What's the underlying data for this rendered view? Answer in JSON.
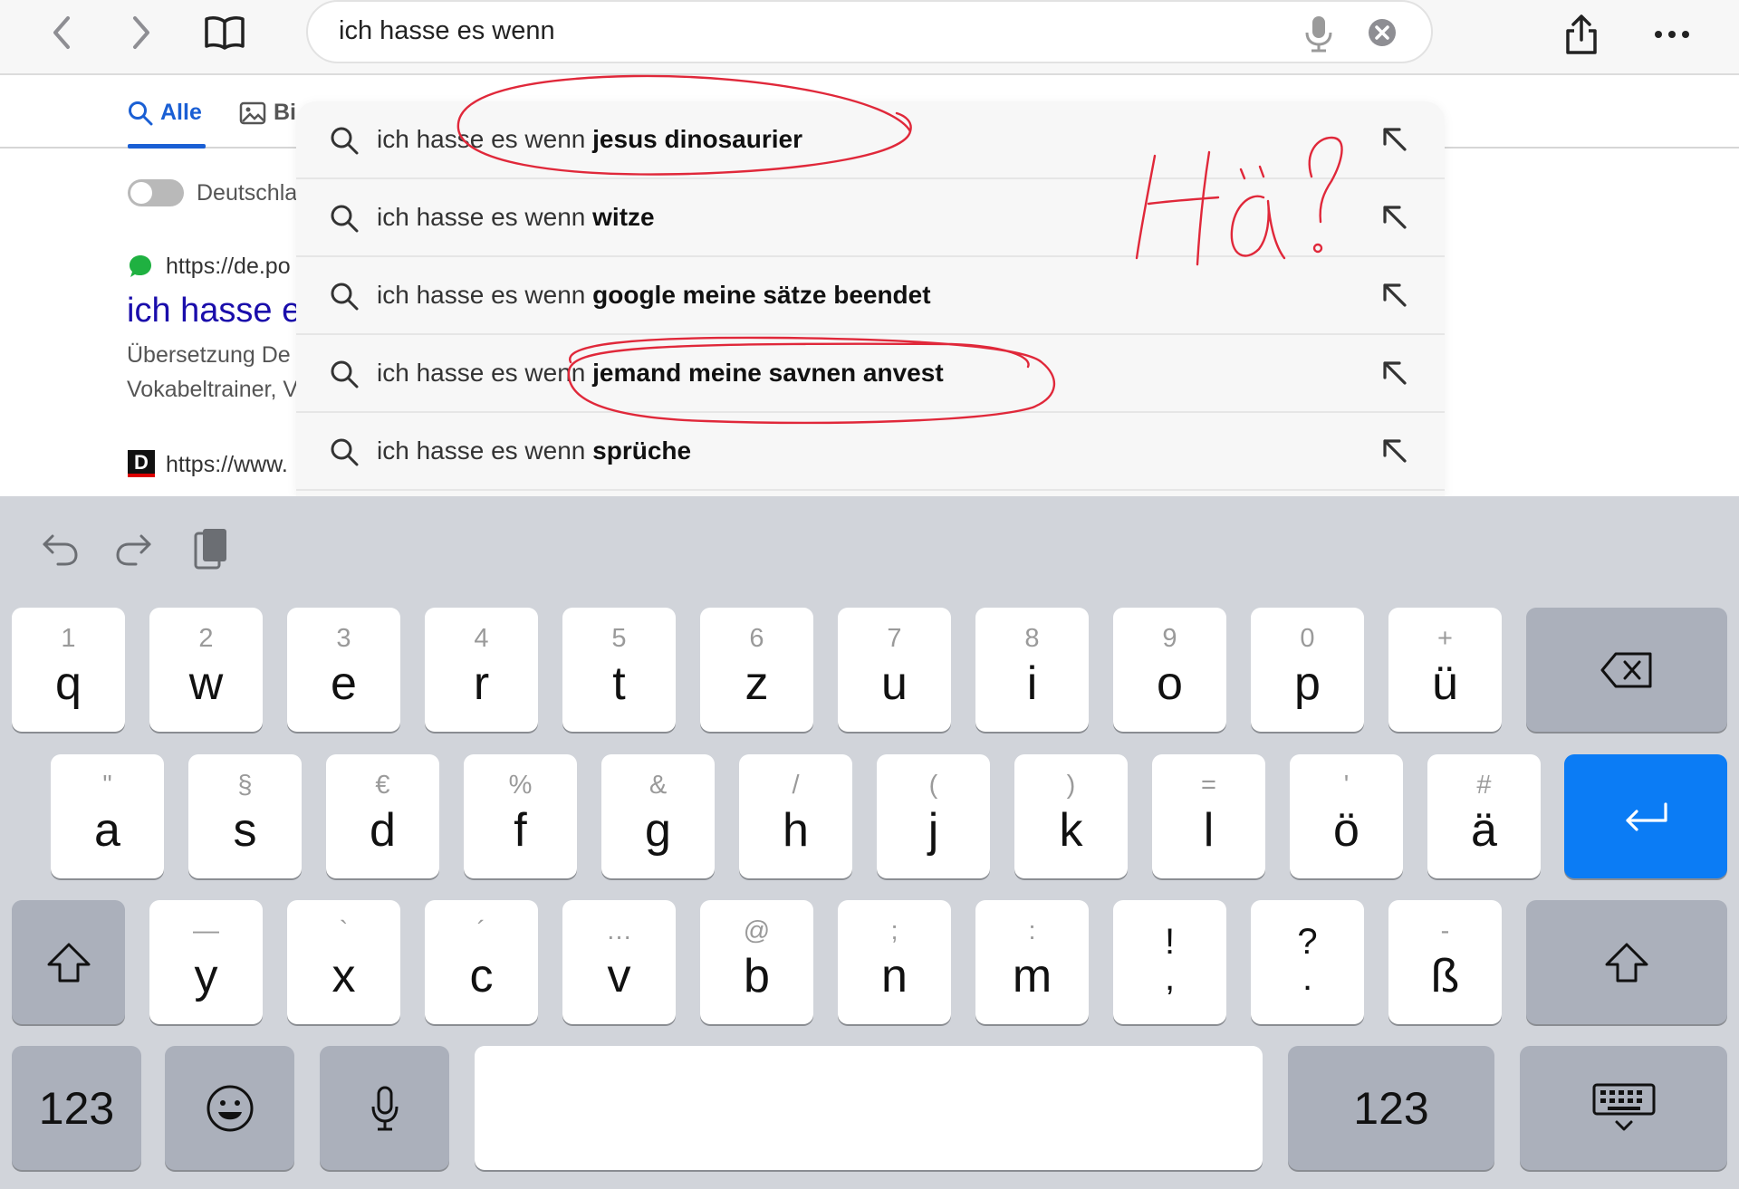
{
  "browser": {
    "search_query": "ich hasse es wenn"
  },
  "results_page": {
    "tabs": {
      "all": "Alle",
      "images": "Bi"
    },
    "region_toggle_label": "Deutschla",
    "result1": {
      "url": "https://de.po",
      "title": "ich hasse e",
      "snippet_line1": "Übersetzung De",
      "snippet_line2": "Vokabeltrainer, V"
    },
    "result2": {
      "favicon_letter": "D",
      "url": "https://www."
    }
  },
  "suggestions": [
    {
      "prefix": "ich hasse es wenn ",
      "completion": "jesus dinosaurier"
    },
    {
      "prefix": "ich hasse es wenn ",
      "completion": "witze"
    },
    {
      "prefix": "ich hasse es wenn ",
      "completion": "google meine sätze beendet"
    },
    {
      "prefix": "ich hasse es wenn ",
      "completion": "jemand meine savnen anvest"
    },
    {
      "prefix": "ich hasse es wenn ",
      "completion": "sprüche"
    }
  ],
  "annotation": {
    "handwritten_text": "Hä?",
    "ink_color": "#e0283a"
  },
  "keyboard": {
    "row1": [
      {
        "sec": "1",
        "main": "q"
      },
      {
        "sec": "2",
        "main": "w"
      },
      {
        "sec": "3",
        "main": "e"
      },
      {
        "sec": "4",
        "main": "r"
      },
      {
        "sec": "5",
        "main": "t"
      },
      {
        "sec": "6",
        "main": "z"
      },
      {
        "sec": "7",
        "main": "u"
      },
      {
        "sec": "8",
        "main": "i"
      },
      {
        "sec": "9",
        "main": "o"
      },
      {
        "sec": "0",
        "main": "p"
      },
      {
        "sec": "+",
        "main": "ü"
      }
    ],
    "row2": [
      {
        "sec": "\"",
        "main": "a"
      },
      {
        "sec": "§",
        "main": "s"
      },
      {
        "sec": "€",
        "main": "d"
      },
      {
        "sec": "%",
        "main": "f"
      },
      {
        "sec": "&",
        "main": "g"
      },
      {
        "sec": "/",
        "main": "h"
      },
      {
        "sec": "(",
        "main": "j"
      },
      {
        "sec": ")",
        "main": "k"
      },
      {
        "sec": "=",
        "main": "l"
      },
      {
        "sec": "'",
        "main": "ö"
      },
      {
        "sec": "#",
        "main": "ä"
      }
    ],
    "row3": [
      {
        "sec": "—",
        "main": "y"
      },
      {
        "sec": "`",
        "main": "x"
      },
      {
        "sec": "´",
        "main": "c"
      },
      {
        "sec": "…",
        "main": "v"
      },
      {
        "sec": "@",
        "main": "b"
      },
      {
        "sec": ";",
        "main": "n"
      },
      {
        "sec": ":",
        "main": "m"
      }
    ],
    "punct_keys": [
      {
        "top": "!",
        "bottom": ","
      },
      {
        "top": "?",
        "bottom": "."
      }
    ],
    "eszett": {
      "sec": "-",
      "main": "ß"
    },
    "numbers_label": "123",
    "accent_blue": "#0b7cf5"
  }
}
